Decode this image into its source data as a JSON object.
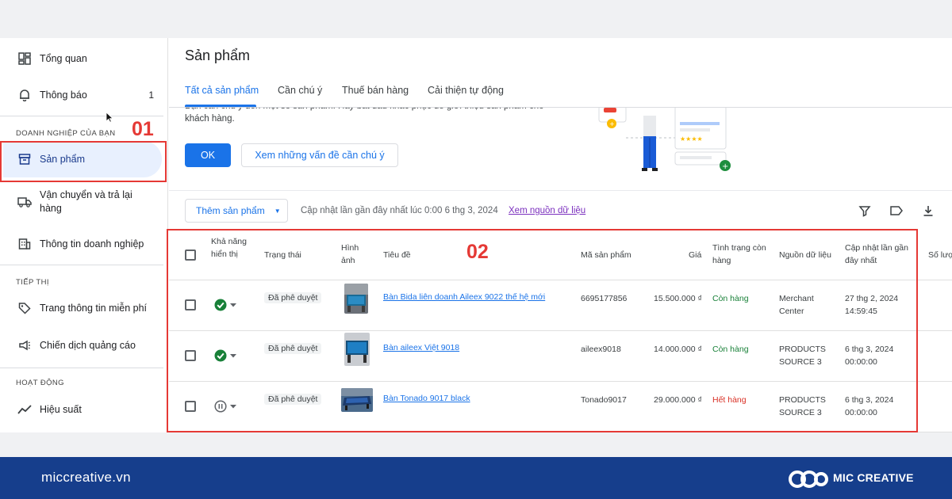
{
  "sidebar": {
    "items_top": [
      {
        "label": "Tổng quan",
        "icon": "dashboard-icon"
      },
      {
        "label": "Thông báo",
        "icon": "bell-icon",
        "count": "1"
      }
    ],
    "section_business": "DOANH NGHIỆP CỦA BẠN",
    "items_business": [
      {
        "label": "Sản phẩm",
        "icon": "product-box-icon"
      },
      {
        "label": "Vận chuyển và trả lại hàng",
        "icon": "truck-icon"
      },
      {
        "label": "Thông tin doanh nghiệp",
        "icon": "building-icon"
      }
    ],
    "section_marketing": "TIẾP THỊ",
    "items_marketing": [
      {
        "label": "Trang thông tin miễn phí",
        "icon": "tag-icon"
      },
      {
        "label": "Chiến dịch quảng cáo",
        "icon": "megaphone-icon"
      }
    ],
    "section_activity": "HOẠT ĐỘNG",
    "items_activity": [
      {
        "label": "Hiệu suất",
        "icon": "trend-icon"
      }
    ]
  },
  "annotations": {
    "box1": "01",
    "box2": "02"
  },
  "main": {
    "title": "Sản phẩm",
    "tabs": [
      "Tất cả sản phẩm",
      "Cần chú ý",
      "Thuế bán hàng",
      "Cải thiện tự động"
    ],
    "banner": {
      "text": "Bạn cần chú ý đến một số sản phẩm. Hãy bắt đầu khắc phục để giới thiệu sản phẩm cho khách hàng.",
      "ok_label": "OK",
      "issues_label": "Xem những vấn đề cần chú ý"
    },
    "toolbar": {
      "add_label": "Thêm sản phẩm",
      "update_text": "Cập nhật lần gần đây nhất lúc 0:00 6 thg 3, 2024",
      "source_link": "Xem nguồn dữ liệu",
      "icons": [
        "filter-icon",
        "label-icon",
        "download-icon"
      ]
    }
  },
  "table": {
    "headers": {
      "visibility": "Khả năng hiển thị",
      "status": "Trạng thái",
      "image": "Hình ảnh",
      "title": "Tiêu đề",
      "sku": "Mã sản phẩm",
      "price": "Giá",
      "stock": "Tình trạng còn hàng",
      "source": "Nguồn dữ liệu",
      "updated": "Cập nhật lần gần đây nhất",
      "qty": "Số lượ"
    },
    "rows": [
      {
        "visibility": "check-circle-icon",
        "status": "Đã phê duyệt",
        "title": "Bàn Bida liên doanh Aileex 9022 thế hệ mới",
        "sku": "6695177856",
        "price": "15.500.000 ₫",
        "stock": "Còn hàng",
        "stock_state": "in",
        "source": "Merchant Center",
        "updated_date": "27 thg 2, 2024",
        "updated_time": "14:59:45"
      },
      {
        "visibility": "check-circle-icon",
        "status": "Đã phê duyệt",
        "title": "Bàn aileex Việt 9018",
        "sku": "aileex9018",
        "price": "14.000.000 ₫",
        "stock": "Còn hàng",
        "stock_state": "in",
        "source": "PRODUCTS SOURCE 3",
        "updated_date": "6 thg 3, 2024",
        "updated_time": "00:00:00"
      },
      {
        "visibility": "pause-circle-icon",
        "status": "Đã phê duyệt",
        "title": "Bàn Tonado 9017 black",
        "sku": "Tonado9017",
        "price": "29.000.000 ₫",
        "stock": "Hết hàng",
        "stock_state": "out",
        "source": "PRODUCTS SOURCE 3",
        "updated_date": "6 thg 3, 2024",
        "updated_time": "00:00:00"
      }
    ]
  },
  "footer": {
    "site": "miccreative.vn",
    "brand": "MIC CREATIVE"
  },
  "colors": {
    "accent": "#1a73e8",
    "annotation": "#e53935",
    "footer": "#163e8c",
    "in_stock": "#188038",
    "out_of_stock": "#d93025"
  }
}
